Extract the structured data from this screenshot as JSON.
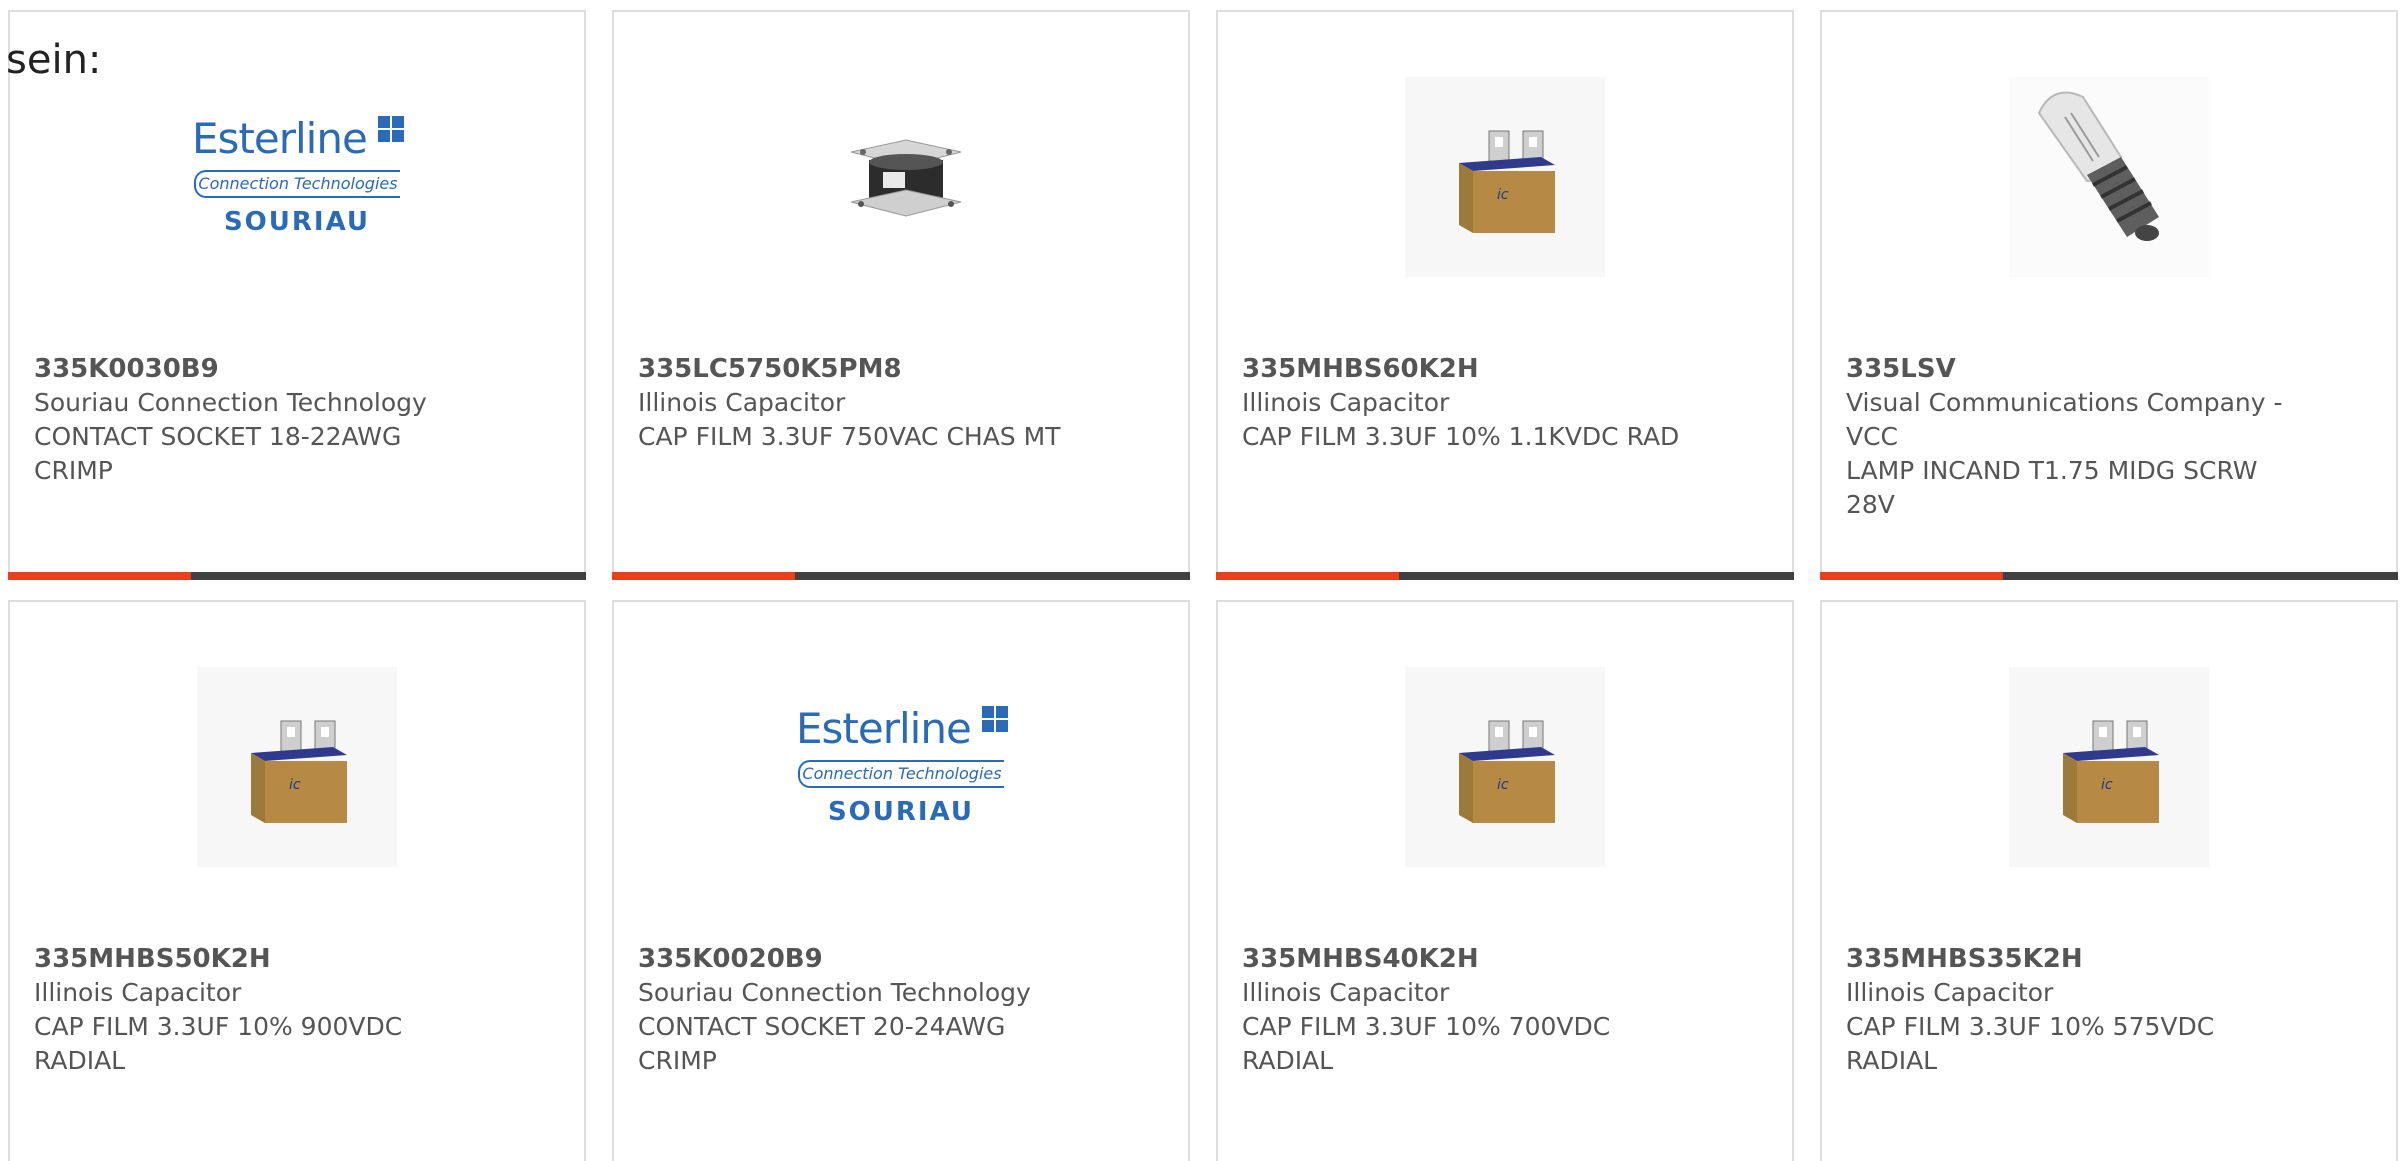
{
  "lead_text": "sein:",
  "colors": {
    "accent": "#e8401c",
    "bar": "#404040",
    "border": "#dedede",
    "text": "#555555",
    "logo_blue": "#2a6ab6"
  },
  "logo": {
    "name": "Esterline",
    "sub": "Connection Technologies",
    "brand": "SOURIAU"
  },
  "products": [
    {
      "part_number": "335K0030B9",
      "manufacturer": "Souriau Connection Technology",
      "description": "CONTACT SOCKET 18-22AWG CRIMP",
      "image": "esterline-souriau-logo"
    },
    {
      "part_number": "335LC5750K5PM8",
      "manufacturer": "Illinois Capacitor",
      "description": "CAP FILM 3.3UF 750VAC CHAS MT",
      "image": "chassis-mount-capacitor"
    },
    {
      "part_number": "335MHBS60K2H",
      "manufacturer": "Illinois Capacitor",
      "description": "CAP FILM 3.3UF 10% 1.1KVDC RAD",
      "image": "box-film-capacitor"
    },
    {
      "part_number": "335LSV",
      "manufacturer": "Visual Communications Company - VCC",
      "description": "LAMP INCAND T1.75 MIDG SCRW 28V",
      "image": "incandescent-lamp"
    },
    {
      "part_number": "335MHBS50K2H",
      "manufacturer": "Illinois Capacitor",
      "description": "CAP FILM 3.3UF 10% 900VDC RADIAL",
      "image": "box-film-capacitor"
    },
    {
      "part_number": "335K0020B9",
      "manufacturer": "Souriau Connection Technology",
      "description": "CONTACT SOCKET 20-24AWG CRIMP",
      "image": "esterline-souriau-logo"
    },
    {
      "part_number": "335MHBS40K2H",
      "manufacturer": "Illinois Capacitor",
      "description": "CAP FILM 3.3UF 10% 700VDC RADIAL",
      "image": "box-film-capacitor"
    },
    {
      "part_number": "335MHBS35K2H",
      "manufacturer": "Illinois Capacitor",
      "description": "CAP FILM 3.3UF 10% 575VDC RADIAL",
      "image": "box-film-capacitor"
    }
  ]
}
